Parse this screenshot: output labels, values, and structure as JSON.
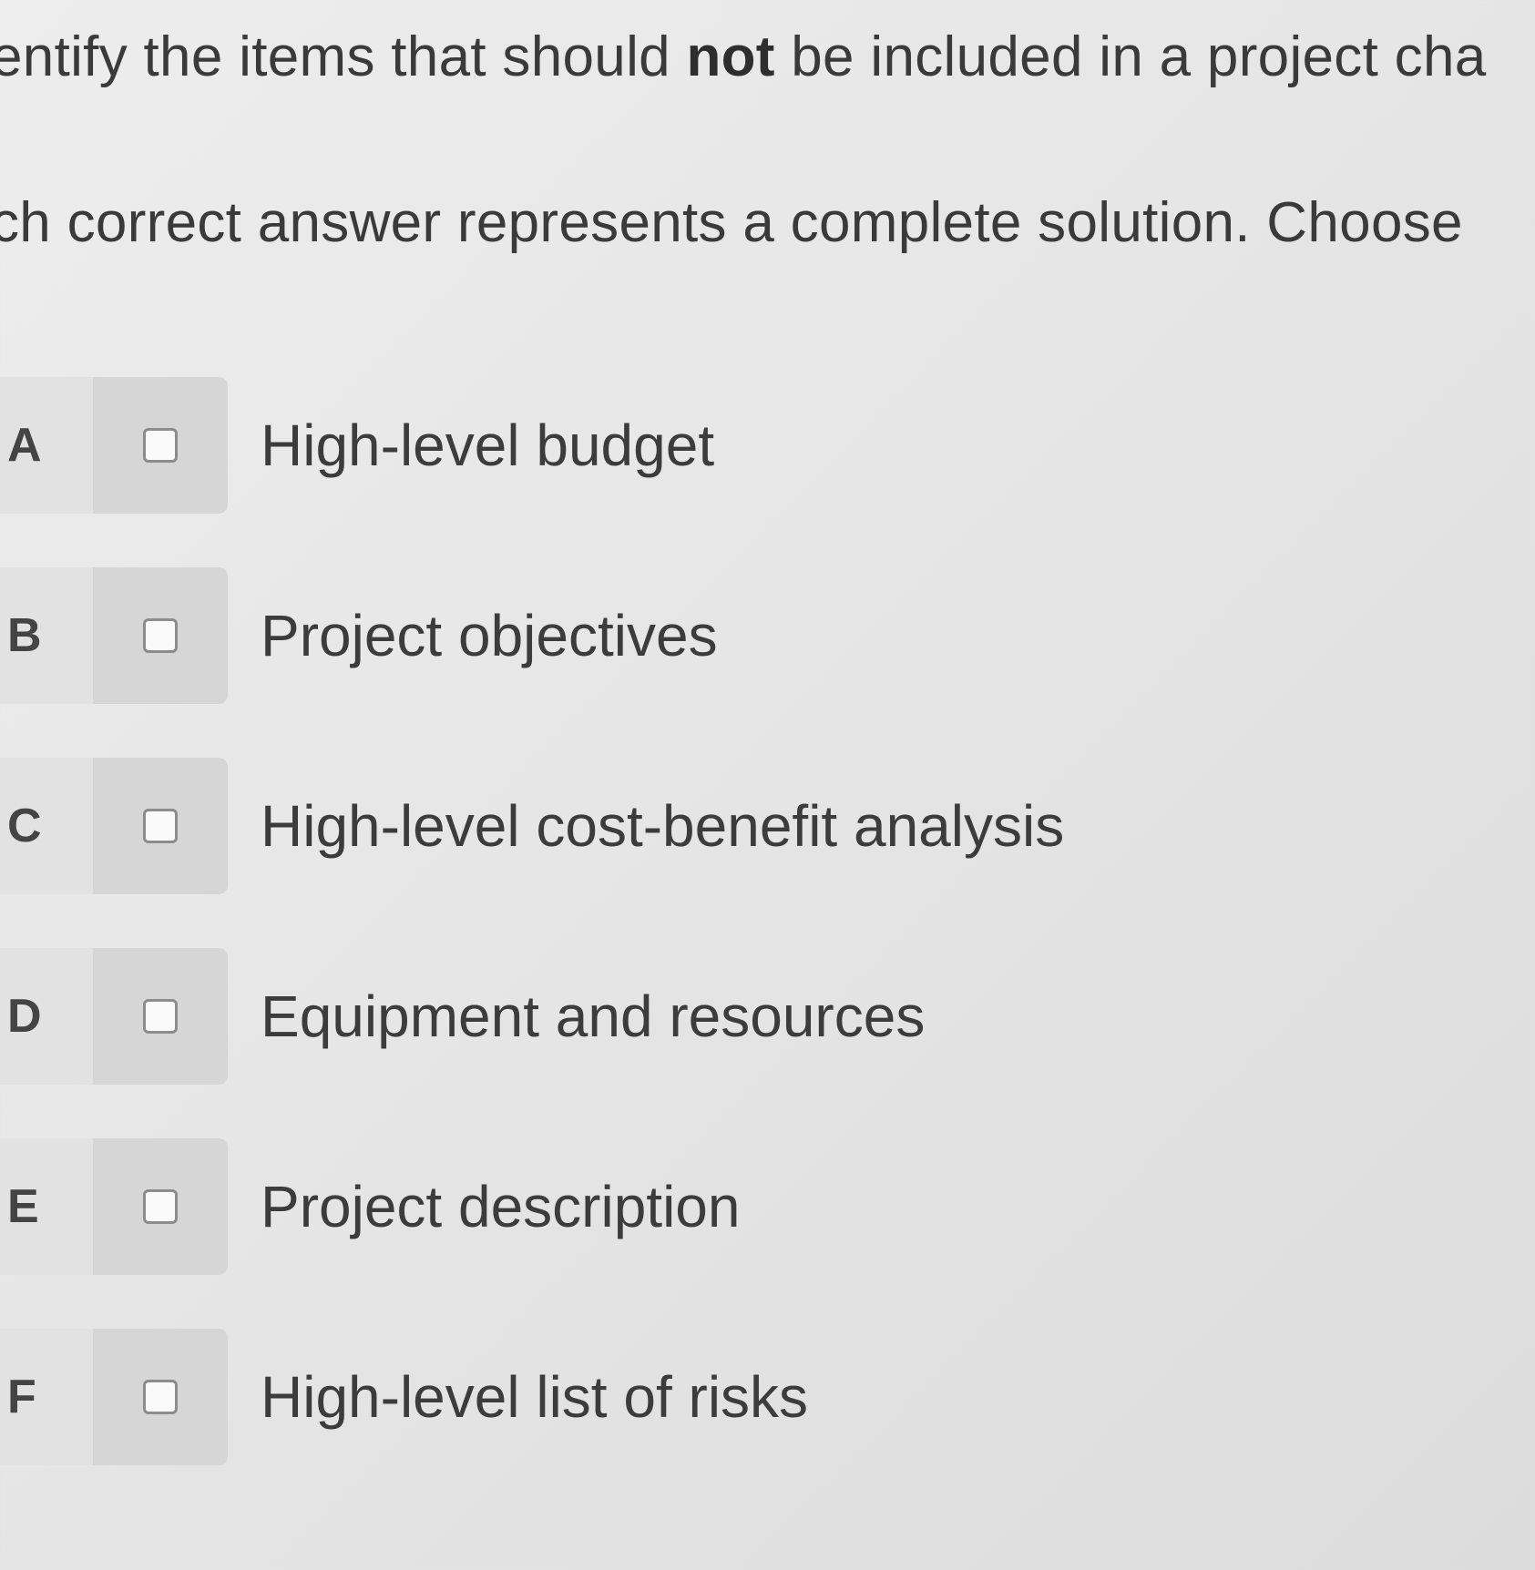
{
  "question": {
    "line1_before": "entify the items that should ",
    "line1_emphasis": "not",
    "line1_after": " be included in a project cha",
    "line2": "ch correct answer represents a complete solution. Choose"
  },
  "options": [
    {
      "letter": "A",
      "label": "High-level budget",
      "checked": false
    },
    {
      "letter": "B",
      "label": "Project objectives",
      "checked": false
    },
    {
      "letter": "C",
      "label": "High-level cost-benefit analysis",
      "checked": false
    },
    {
      "letter": "D",
      "label": "Equipment and resources",
      "checked": false
    },
    {
      "letter": "E",
      "label": "Project description",
      "checked": false
    },
    {
      "letter": "F",
      "label": "High-level list of risks",
      "checked": false
    }
  ]
}
